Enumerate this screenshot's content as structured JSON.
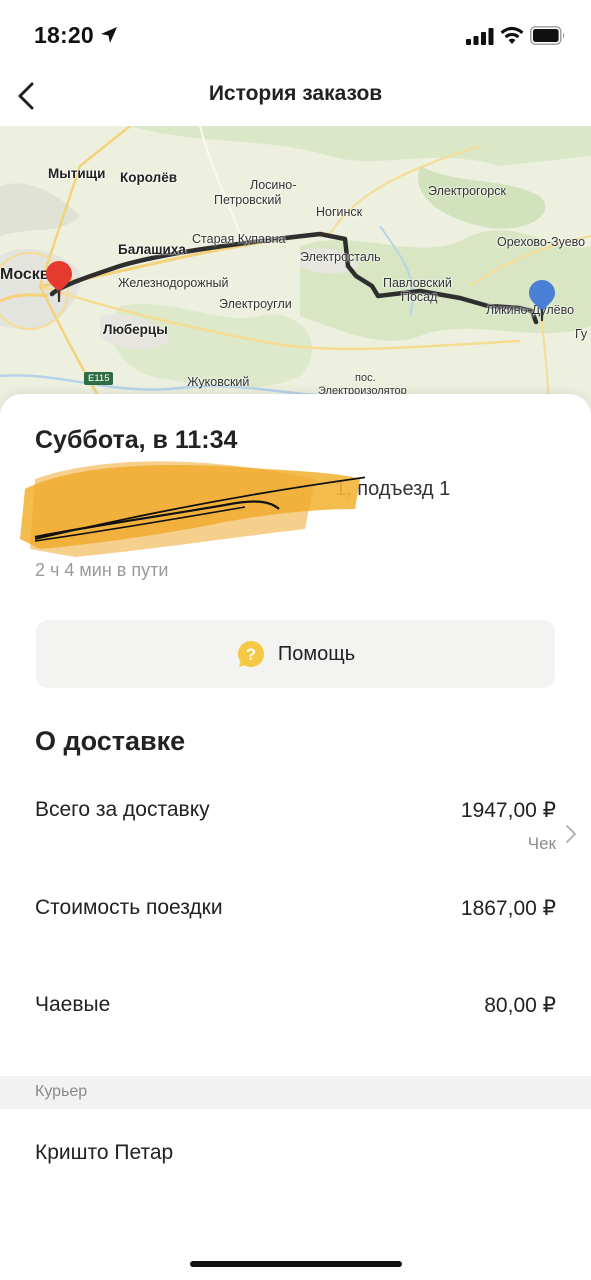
{
  "status_bar": {
    "time": "18:20"
  },
  "header": {
    "title": "История заказов"
  },
  "map": {
    "labels": {
      "mytishchi": "Мытищи",
      "korolev": "Королёв",
      "losino": "Лосино-",
      "petrovsky": "Петровский",
      "elektrogorsk": "Электрогорск",
      "noginsk": "Ногинск",
      "balashikha": "Балашиха",
      "staraya_kupavna": "Старая Купавна",
      "elektrostal": "Электросталь",
      "orekhovo_zuevo": "Орехово-Зуево",
      "moskva": "Москва",
      "zheleznodorozhny": "Железнодорожный",
      "pavlovsky": "Павловский",
      "posad": "Посад",
      "likino_dulevo": "Ликино-Дулёво",
      "elektrougli": "Электроугли",
      "lyubertsy": "Люберцы",
      "gu": "Гу",
      "e115": "E115",
      "zhukovsky": "Жуковский",
      "pos": "пос.",
      "elektroizolyator": "Электроизолятор"
    }
  },
  "order": {
    "date": "Суббота, в 11:34",
    "address_visible": "1, подъезд 1",
    "travel_time": "2 ч 4 мин в пути"
  },
  "help": {
    "label": "Помощь"
  },
  "delivery": {
    "title": "О доставке",
    "total_label": "Всего за доставку",
    "total_value": "1947,00 ₽",
    "receipt_label": "Чек",
    "ride_label": "Стоимость поездки",
    "ride_value": "1867,00 ₽",
    "tips_label": "Чаевые",
    "tips_value": "80,00 ₽"
  },
  "courier": {
    "section_label": "Курьер",
    "name": "Кришто Петар"
  },
  "colors": {
    "pin_start": "#e63a2e",
    "pin_end": "#4a7fd6",
    "route": "#2e2e2e",
    "redaction": "#f3b53a"
  }
}
